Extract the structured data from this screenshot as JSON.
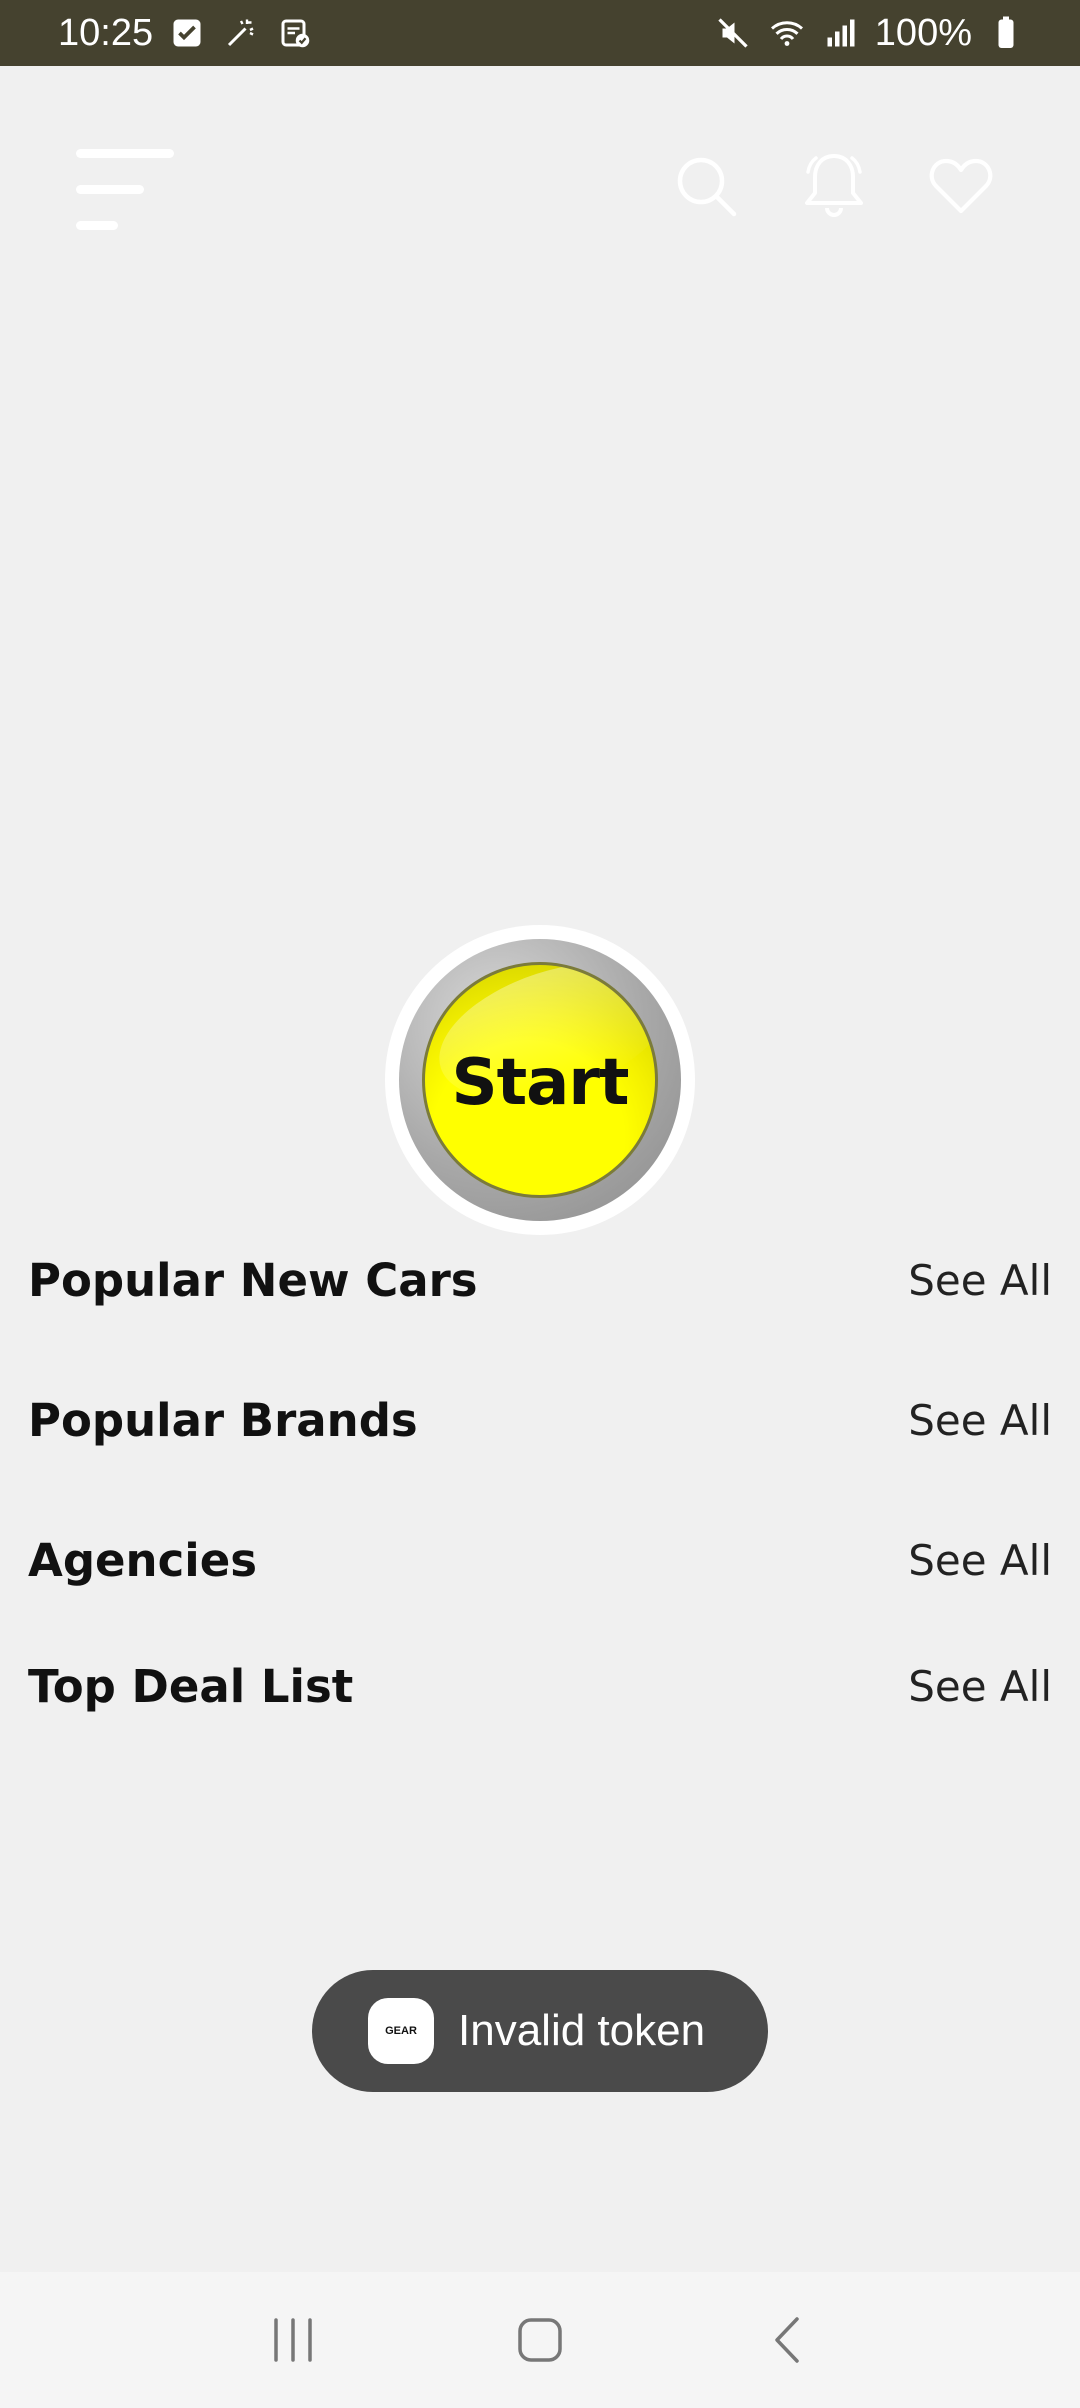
{
  "status_bar": {
    "time": "10:25",
    "battery": "100%",
    "icons_left": [
      "checkbox-notification-icon",
      "magic-wand-icon",
      "clipboard-check-icon"
    ],
    "icons_right": [
      "mute-icon",
      "wifi-icon",
      "signal-icon",
      "battery-icon"
    ]
  },
  "header": {
    "menu_icon": "menu-icon",
    "search_icon": "search-icon",
    "notification_icon": "bell-icon",
    "favorites_icon": "heart-icon"
  },
  "start_button": {
    "label": "Start",
    "color": "#ffff00"
  },
  "sections": [
    {
      "title": "Popular New Cars",
      "action": "See All"
    },
    {
      "title": "Popular Brands",
      "action": "See All"
    },
    {
      "title": "Agencies",
      "action": "See All"
    },
    {
      "title": "Top Deal List",
      "action": "See All"
    }
  ],
  "toast": {
    "message": "Invalid token",
    "logo_text": "GEAR"
  },
  "nav_bar": {
    "recents_icon": "recents-icon",
    "home_icon": "home-icon",
    "back_icon": "back-icon"
  }
}
